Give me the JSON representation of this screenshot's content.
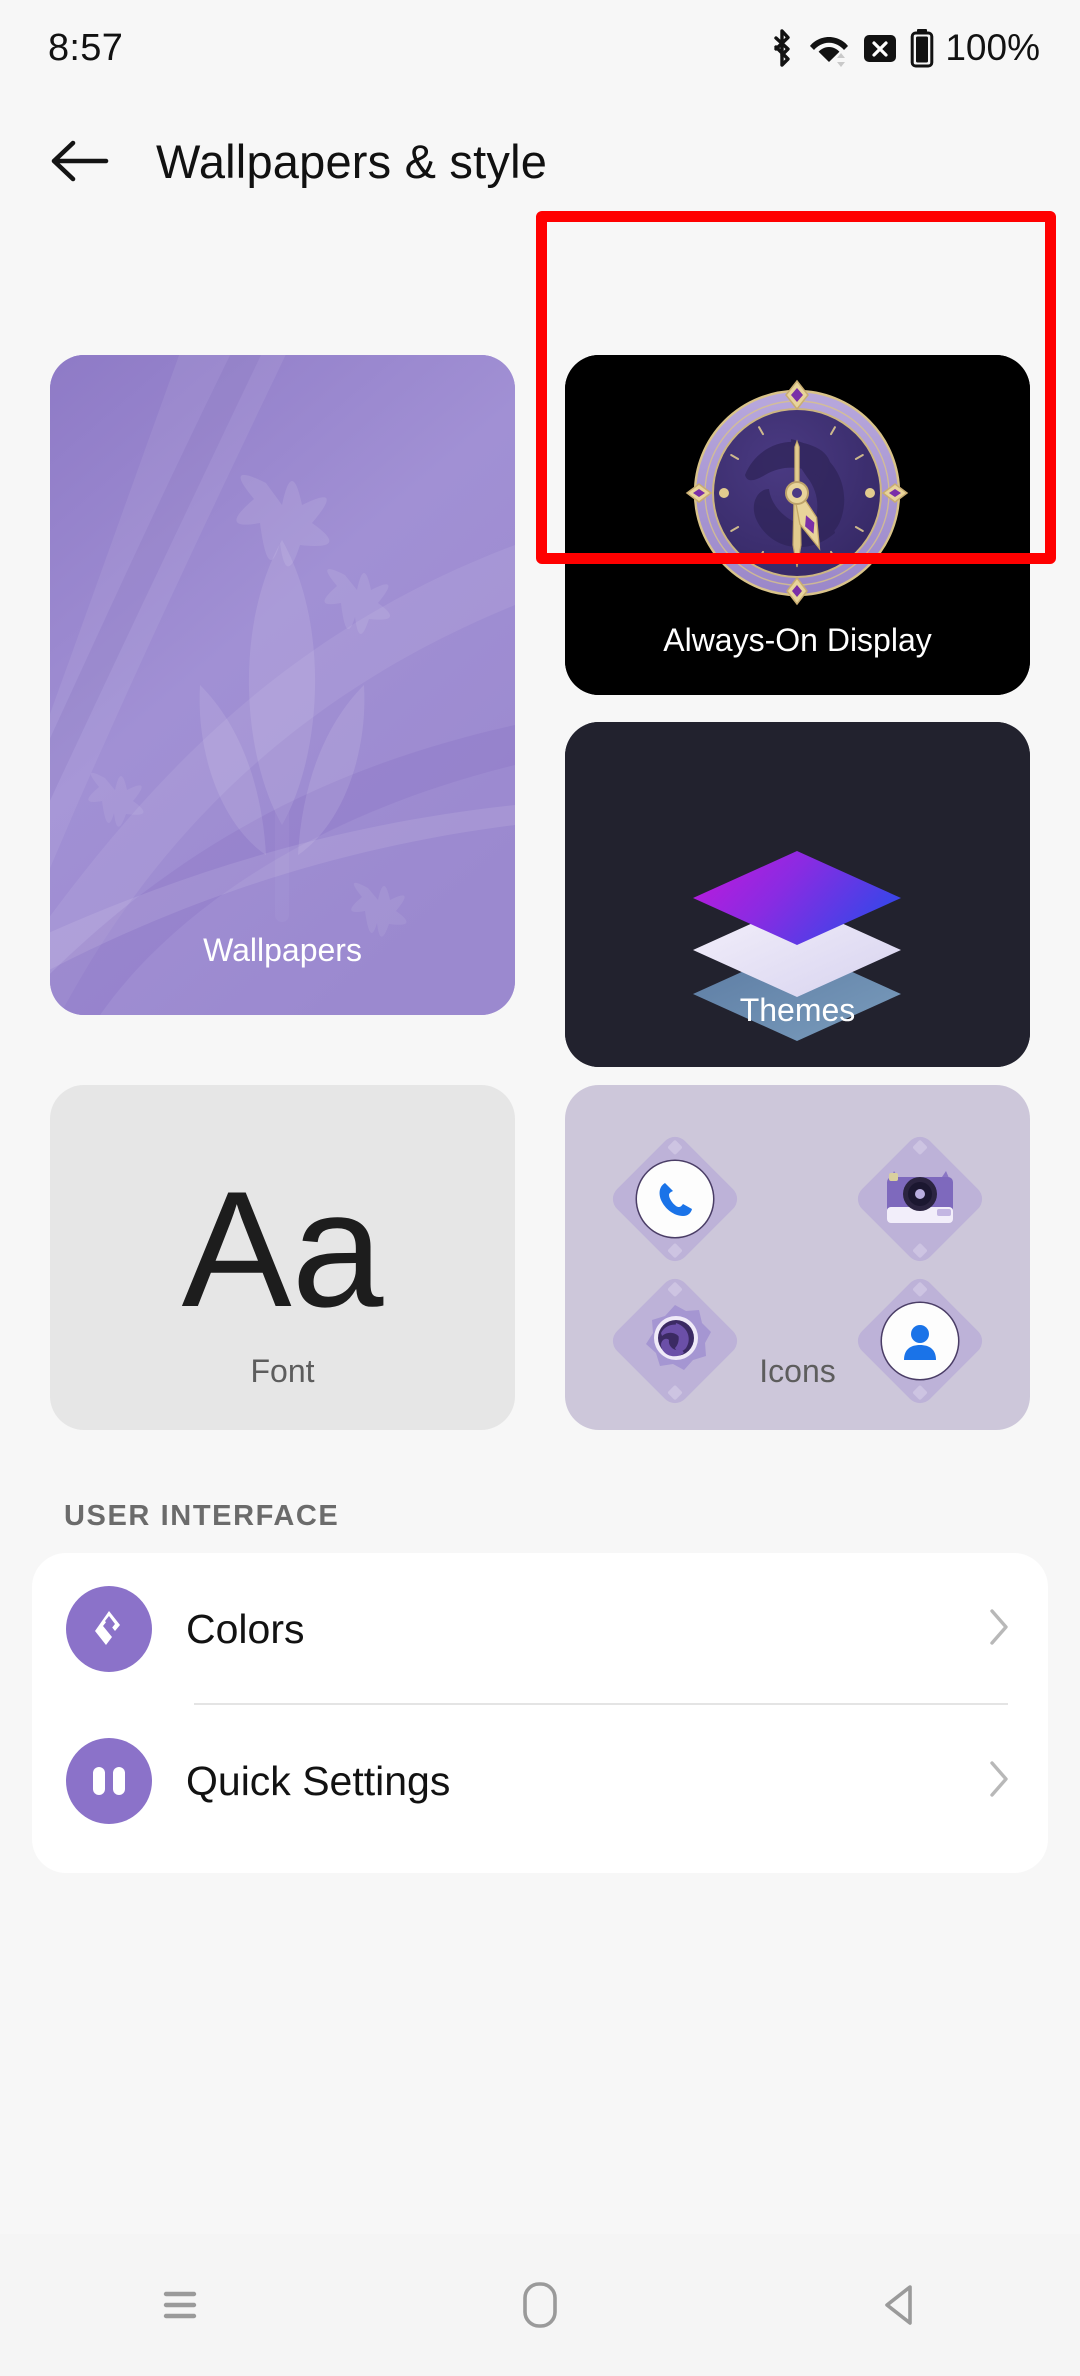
{
  "status_bar": {
    "time": "8:57",
    "battery_text": "100%",
    "icons": [
      "bluetooth-icon",
      "wifi-icon",
      "sim-no-signal-icon",
      "battery-icon"
    ]
  },
  "app_bar": {
    "back_icon": "back-arrow-icon",
    "title": "Wallpapers & style"
  },
  "tiles": {
    "wallpapers": {
      "label": "Wallpapers"
    },
    "always_on_display": {
      "label": "Always-On Display",
      "clock_icon": "analog-clock-face"
    },
    "themes": {
      "label": "Themes",
      "icon": "stacked-layers-icon"
    },
    "font": {
      "label": "Font",
      "sample": "Aa"
    },
    "icons": {
      "label": "Icons",
      "items": [
        "phone-icon",
        "camera-icon",
        "settings-icon",
        "contacts-icon"
      ]
    }
  },
  "highlight": {
    "color": "#ff0000",
    "target": "always-on-display-card"
  },
  "section": {
    "title": "USER INTERFACE"
  },
  "list": [
    {
      "label": "Colors",
      "icon": "palette-icon",
      "chevron": "chevron-right-icon"
    },
    {
      "label": "Quick Settings",
      "icon": "quick-settings-icon",
      "chevron": "chevron-right-icon"
    }
  ],
  "nav_bar": {
    "recents_label": "recents-icon",
    "home_label": "home-icon",
    "back_label": "back-icon"
  },
  "colors": {
    "accent_purple": "#8b72c9",
    "card_purple": "#9b89cf",
    "dark_card": "#22222e",
    "font_card": "#e6e6e6",
    "icons_card": "#cdc7da",
    "highlight_red": "#ff0000",
    "background": "#f7f7f7"
  }
}
